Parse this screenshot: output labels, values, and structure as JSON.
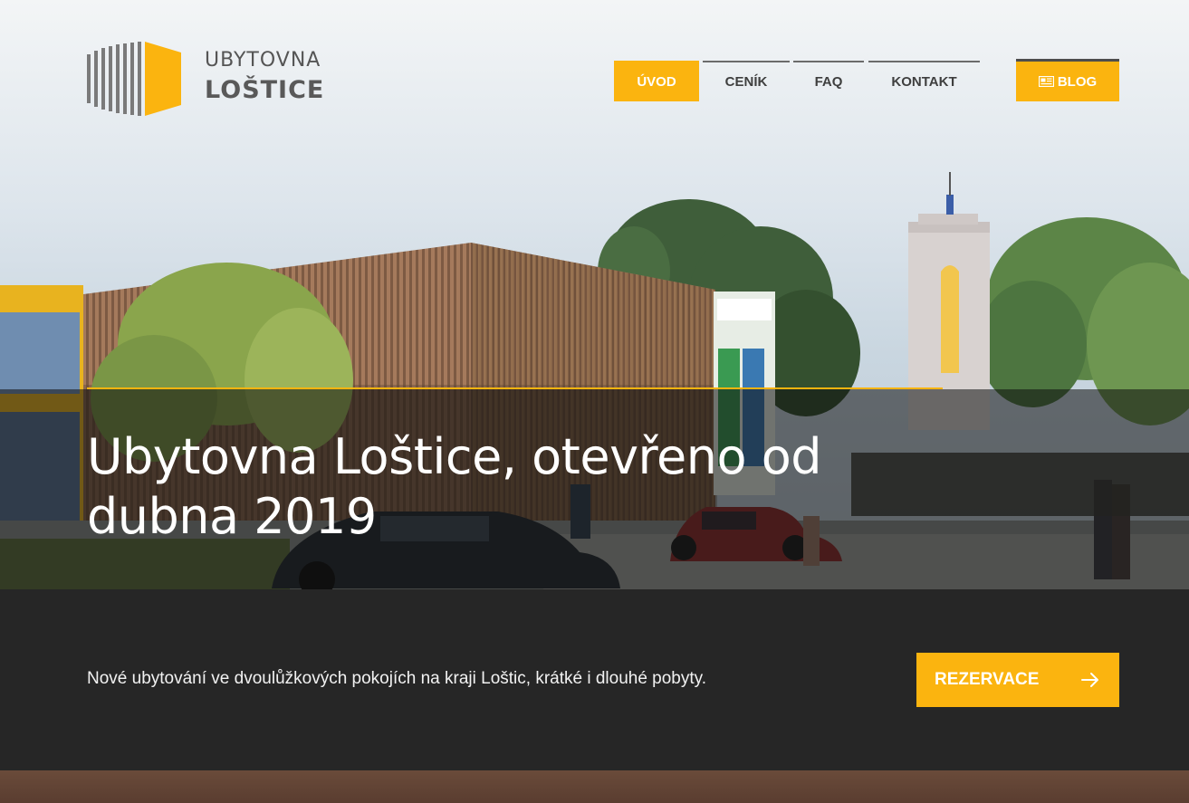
{
  "logo": {
    "line1": "UBYTOVNA",
    "line2": "LOŠTICE"
  },
  "nav": {
    "items": [
      {
        "label": "ÚVOD",
        "active": true
      },
      {
        "label": "CENÍK",
        "active": false
      },
      {
        "label": "FAQ",
        "active": false
      },
      {
        "label": "KONTAKT",
        "active": false
      }
    ],
    "blog_label": "BLOG"
  },
  "hero": {
    "headline": "Ubytovna Loštice, otevřeno od dubna 2019"
  },
  "cta": {
    "text": "Nové ubytování ve dvoulůžkových pokojích na kraji Loštic, krátké i dlouhé pobyty.",
    "button_label": "REZERVACE"
  },
  "colors": {
    "accent": "#fbb40f",
    "dark": "#262626"
  }
}
